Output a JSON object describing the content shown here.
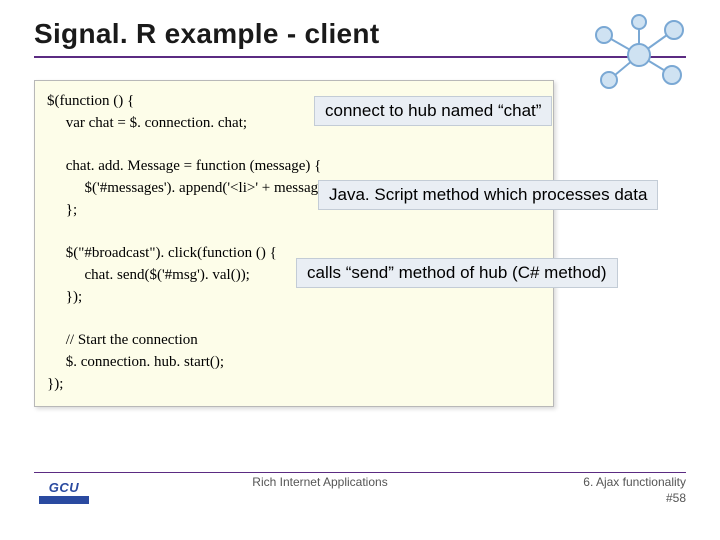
{
  "title": "Signal. R example - client",
  "code": {
    "l1": "$(function () {",
    "l2": "     var chat = $. connection. chat;",
    "blank1": "",
    "l3": "     chat. add. Message = function (message) {",
    "l4": "          $('#messages'). append('<li>' + message + '</li>');",
    "l5": "     };",
    "blank2": "",
    "l6": "     $(\"#broadcast\"). click(function () {",
    "l7": "          chat. send($('#msg'). val());",
    "l8": "     });",
    "blank3": "",
    "l9": "     // Start the connection",
    "l10": "     $. connection. hub. start();",
    "l11": "});"
  },
  "notes": {
    "n1": "connect to hub named “chat”",
    "n2": "Java. Script method which processes data",
    "n3": "calls “send” method of hub (C# method)"
  },
  "footer": {
    "center": "Rich Internet Applications",
    "right1": "6. Ajax functionality",
    "right2": "#58"
  },
  "logo": {
    "text": "GCU"
  }
}
